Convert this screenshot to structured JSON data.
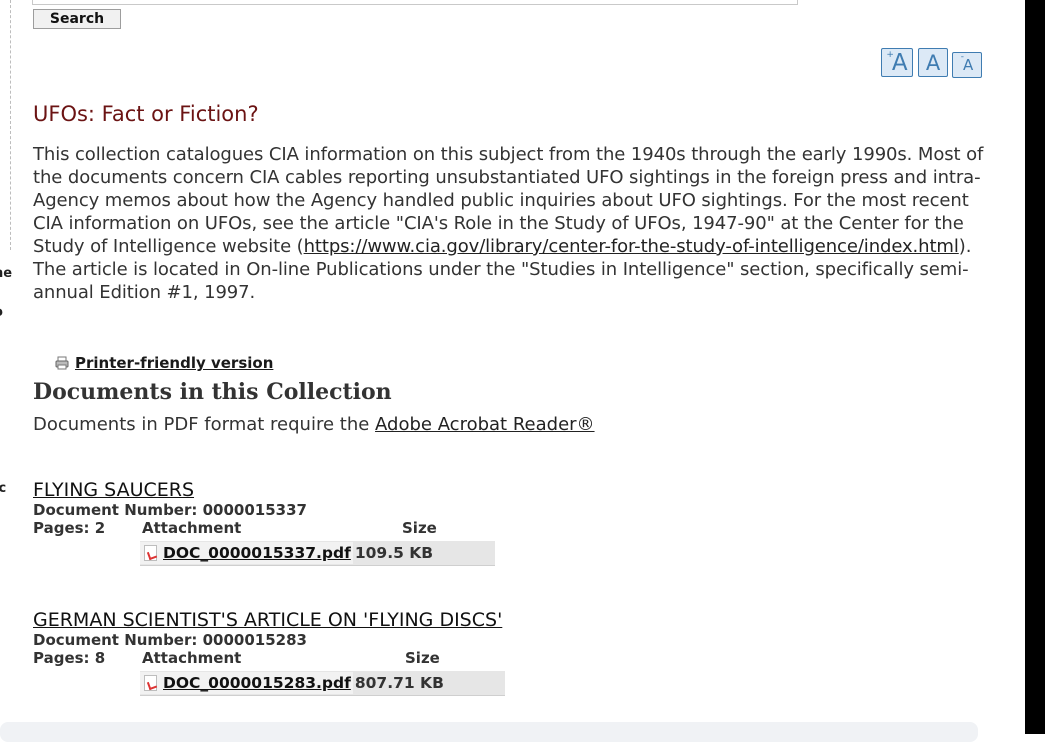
{
  "search": {
    "button_label": "Search"
  },
  "text_size": {
    "increase": "A",
    "normal": "A",
    "decrease": "A",
    "plus": "+",
    "minus": "-"
  },
  "left_edge_fragments": [
    "ne",
    "o",
    "ic"
  ],
  "collection": {
    "title": "UFOs: Fact or Fiction?",
    "desc_part1": "This collection catalogues CIA information on this subject from the 1940s through the early 1990s. Most of the documents concern CIA cables reporting unsubstantiated UFO sightings in the foreign press and intra-Agency memos about how the Agency handled public inquiries about UFO sightings. For the most recent CIA information on UFOs, see the article \"CIA's Role in the Study of UFOs, 1947-90\" at the Center for the Study of Intelligence website (",
    "desc_link": "https://www.cia.gov/library/center-for-the-study-of-intelligence/index.html",
    "desc_part2": "). The article is located in On-line Publications under the \"Studies in Intelligence\" section, specifically semi-annual Edition #1, 1997."
  },
  "printer_friendly": {
    "label": "Printer-friendly version"
  },
  "documents_section": {
    "heading": "Documents in this Collection",
    "pdf_note_prefix": "Documents in PDF format require the ",
    "pdf_note_link": "Adobe Acrobat Reader®"
  },
  "documents": [
    {
      "title": "FLYING SAUCERS",
      "doc_number_label": "Document Number: ",
      "doc_number": "0000015337",
      "pages_label": "Pages: ",
      "pages": "2",
      "attachment_header": "Attachment",
      "size_header": "Size",
      "file": "DOC_0000015337.pdf",
      "size": "109.5 KB"
    },
    {
      "title": "GERMAN SCIENTIST'S ARTICLE ON 'FLYING DISCS'",
      "doc_number_label": "Document Number: ",
      "doc_number": "0000015283",
      "pages_label": "Pages: ",
      "pages": "8",
      "attachment_header": "Attachment",
      "size_header": "Size",
      "file": "DOC_0000015283.pdf",
      "size": "807.71 KB"
    }
  ],
  "colors": {
    "title": "#6b1313",
    "text": "#333333",
    "size_button_border": "#3f7cb1",
    "size_button_bg": "#dce9f6"
  }
}
